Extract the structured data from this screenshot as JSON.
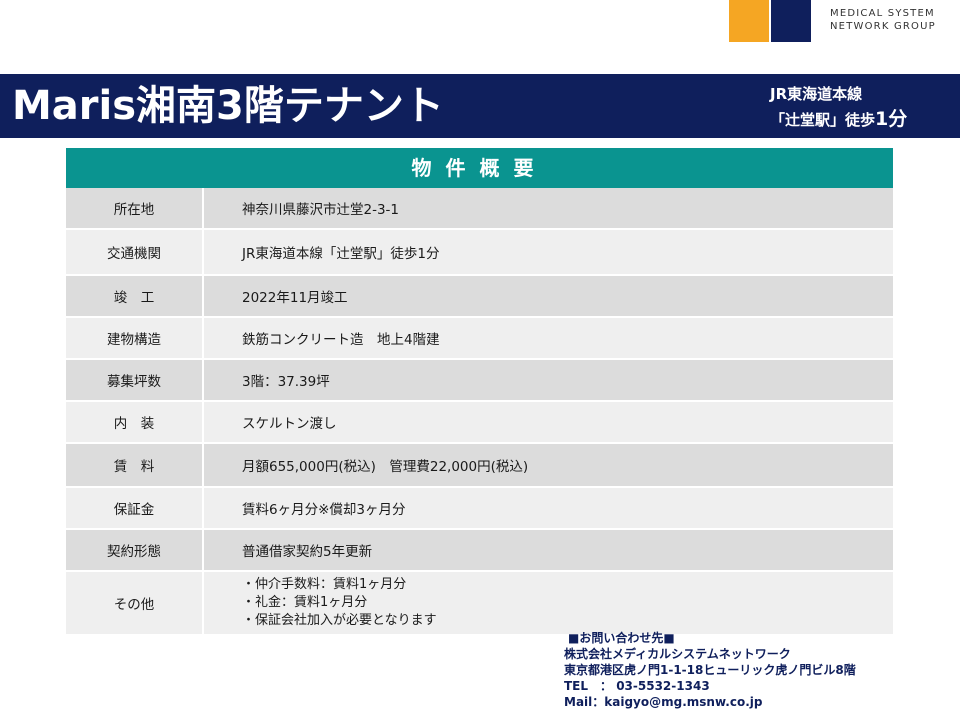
{
  "logo": {
    "line1": "MEDICAL SYSTEM",
    "line2": "NETWORK GROUP",
    "colors": {
      "orange": "#f5a623",
      "navy": "#0f1f5c"
    }
  },
  "header": {
    "title": "Maris湘南3階テナント",
    "access_line1": "JR東海道本線",
    "access_line2_prefix": "「辻堂駅」徒歩",
    "access_line2_num": "1分",
    "bg_color": "#0f1f5c"
  },
  "table": {
    "heading": "物件概要",
    "heading_color": "#0a9490",
    "rows": [
      {
        "label": "所在地",
        "value": "神奈川県藤沢市辻堂2-3-1"
      },
      {
        "label": "交通機関",
        "value": "JR東海道本線「辻堂駅」徒歩1分"
      },
      {
        "label": "竣　工",
        "value": "2022年11月竣工"
      },
      {
        "label": "建物構造",
        "value": "鉄筋コンクリート造　地上4階建"
      },
      {
        "label": "募集坪数",
        "value": "3階：37.39坪"
      },
      {
        "label": "内　装",
        "value": "スケルトン渡し"
      },
      {
        "label": "賃　料",
        "value": "月額655,000円(税込)　管理費22,000円(税込)"
      },
      {
        "label": "保証金",
        "value": "賃料6ヶ月分※償却3ヶ月分"
      },
      {
        "label": "契約形態",
        "value": "普通借家契約5年更新"
      },
      {
        "label": "その他",
        "value_lines": [
          "・仲介手数料：賃料1ヶ月分",
          "・礼金：賃料1ヶ月分",
          "・保証会社加入が必要となります"
        ]
      }
    ]
  },
  "contact": {
    "heading": "■お問い合わせ先■",
    "company": "株式会社メディカルシステムネットワーク",
    "address": "東京都港区虎ノ門1-1-18ヒューリック虎ノ門ビル8階",
    "tel": "TEL　：  03-5532-1343",
    "mail": "Mail：kaigyo@mg.msnw.co.jp"
  }
}
